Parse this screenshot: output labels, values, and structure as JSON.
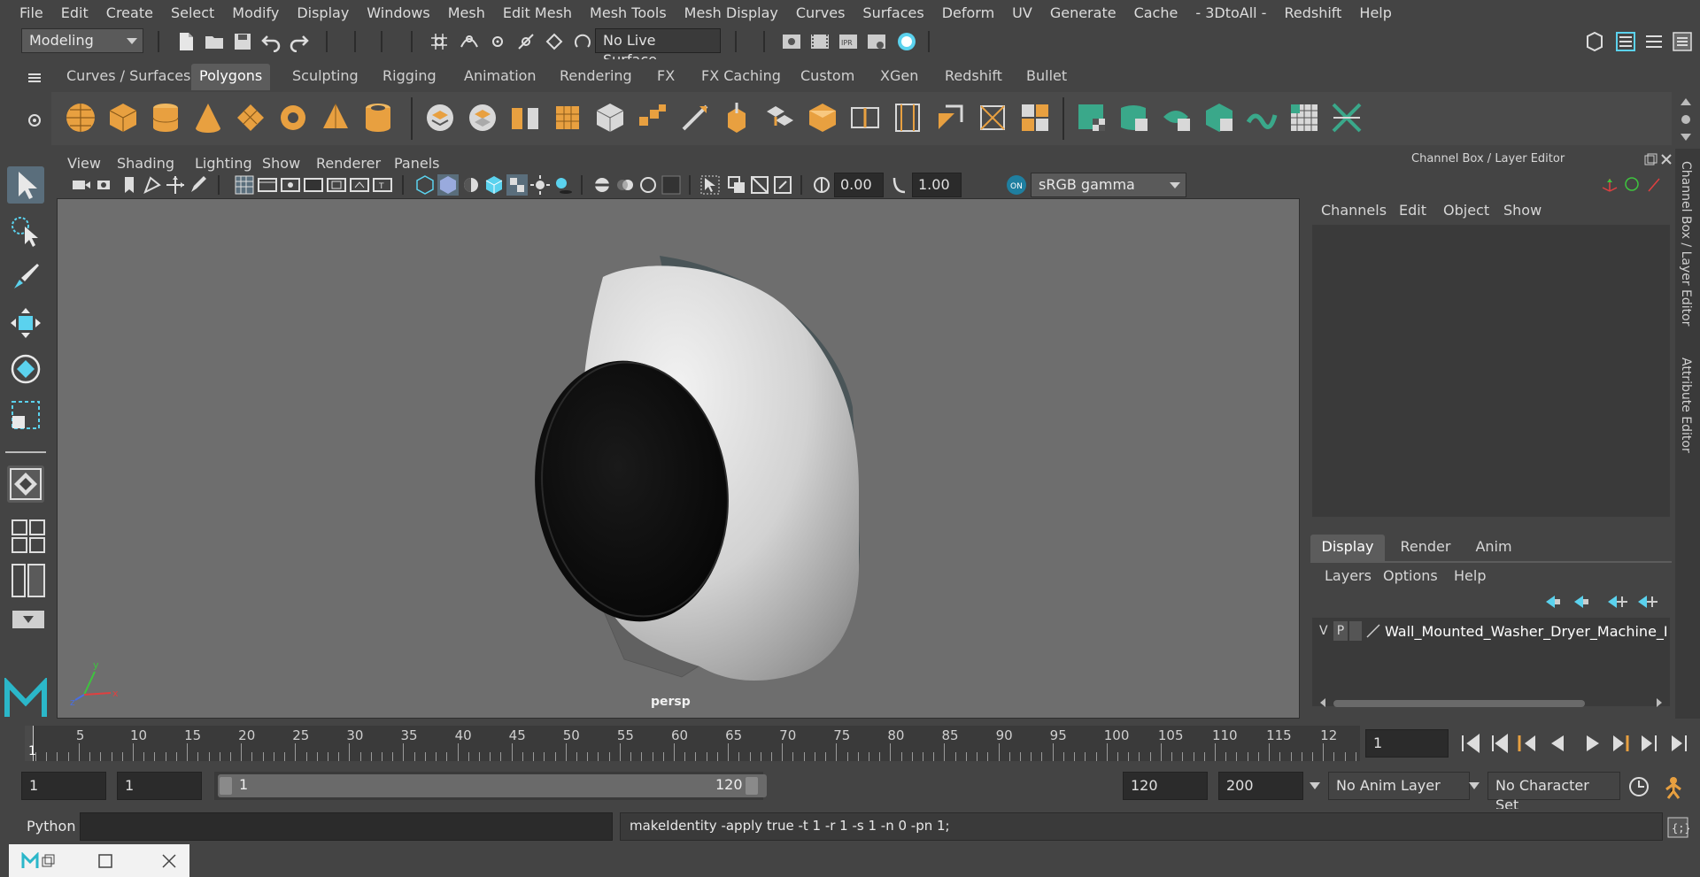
{
  "menubar": [
    "File",
    "Edit",
    "Create",
    "Select",
    "Modify",
    "Display",
    "Windows",
    "Mesh",
    "Edit Mesh",
    "Mesh Tools",
    "Mesh Display",
    "Curves",
    "Surfaces",
    "Deform",
    "UV",
    "Generate",
    "Cache",
    "- 3DtoAll -",
    "Redshift",
    "Help"
  ],
  "statusline": {
    "mode": "Modeling",
    "live_surface": "No Live Surface"
  },
  "shelf": {
    "tabs": [
      "Curves / Surfaces",
      "Polygons",
      "Sculpting",
      "Rigging",
      "Animation",
      "Rendering",
      "FX",
      "FX Caching",
      "Custom",
      "XGen",
      "Redshift",
      "Bullet"
    ],
    "active_tab": "Polygons"
  },
  "viewport": {
    "menus": [
      "View",
      "Shading",
      "Lighting",
      "Show",
      "Renderer",
      "Panels"
    ],
    "exposure": "0.00",
    "gamma": "1.00",
    "colorspace": "sRGB gamma",
    "camera": "persp"
  },
  "channelbox": {
    "title": "Channel Box / Layer Editor",
    "menus": [
      "Channels",
      "Edit",
      "Object",
      "Show"
    ]
  },
  "layereditor": {
    "tabs": [
      "Display",
      "Render",
      "Anim"
    ],
    "active_tab": "Display",
    "menus": [
      "Layers",
      "Options",
      "Help"
    ],
    "layer": {
      "v": "V",
      "p": "P",
      "name": "Wall_Mounted_Washer_Dryer_Machine_Da"
    }
  },
  "sidetabs": [
    "Channel Box / Layer Editor",
    "Attribute Editor"
  ],
  "timeline": {
    "ticks": [
      "5",
      "10",
      "15",
      "20",
      "25",
      "30",
      "35",
      "40",
      "45",
      "50",
      "55",
      "60",
      "65",
      "70",
      "75",
      "80",
      "85",
      "90",
      "95",
      "100",
      "105",
      "110",
      "115",
      "12"
    ],
    "current_marker": "1",
    "current_frame": "1"
  },
  "range": {
    "start": "1",
    "playback_start": "1",
    "slider_start": "1",
    "slider_end": "120",
    "playback_end": "120",
    "end": "200",
    "anim_layer": "No Anim Layer",
    "character_set": "No Character Set"
  },
  "cmdline": {
    "lang": "Python",
    "output": "makeIdentity -apply true -t 1 -r 1 -s 1 -n 0 -pn 1;"
  },
  "colors": {
    "accent": "#5bd2ee",
    "shelf_orange": "#e8a040",
    "shelf_teal": "#3aa88a"
  }
}
